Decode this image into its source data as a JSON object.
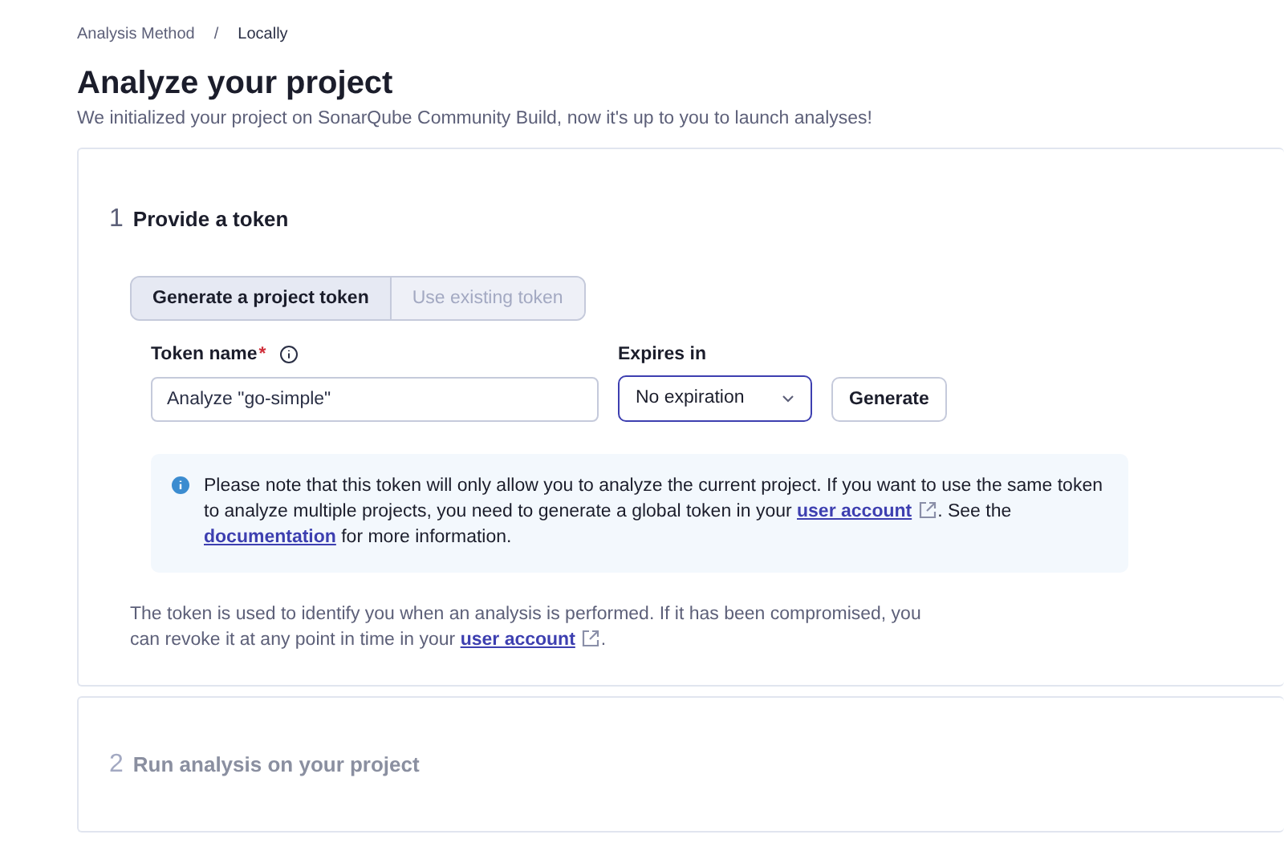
{
  "breadcrumb": [
    "Analysis Method",
    "Locally"
  ],
  "breadcrumb_separator": "/",
  "title": "Analyze your project",
  "subtitle": "We initialized your project on SonarQube Community Build, now it's up to you to launch analyses!",
  "steps": [
    {
      "number": "1",
      "title": "Provide a token",
      "active": true,
      "tabs": [
        {
          "label": "Generate a project token",
          "selected": true
        },
        {
          "label": "Use existing token",
          "selected": false
        }
      ],
      "token_name": {
        "label": "Token name",
        "required": true,
        "required_mark": "*",
        "value": "Analyze \"go-simple\""
      },
      "expires": {
        "label": "Expires in",
        "value": "No expiration"
      },
      "generate_button": "Generate",
      "note": [
        {
          "kind": "text",
          "text": "Please note that this token will only allow you to analyze the current project. If you want to use the same token to analyze multiple projects, you need to generate a global token in your "
        },
        {
          "kind": "link",
          "text": "user account",
          "external": true
        },
        {
          "kind": "text",
          "text": ". See the "
        },
        {
          "kind": "link",
          "text": "documentation",
          "external": false
        },
        {
          "kind": "text",
          "text": " for more information."
        }
      ],
      "help": [
        {
          "kind": "text",
          "text": "The token is used to identify you when an analysis is performed. If it has been compromised, you can revoke it at any point in time in your "
        },
        {
          "kind": "link",
          "text": "user account",
          "external": true
        },
        {
          "kind": "text",
          "text": "."
        }
      ]
    },
    {
      "number": "2",
      "title": "Run analysis on your project",
      "active": false
    }
  ]
}
